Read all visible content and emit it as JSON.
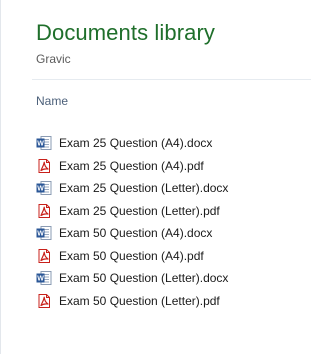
{
  "library": {
    "title": "Documents library",
    "subtitle": "Gravic"
  },
  "columns": {
    "name_label": "Name"
  },
  "files": [
    {
      "name": "Exam 25 Question (A4).docx",
      "icon": "word-document-icon"
    },
    {
      "name": "Exam 25 Question (A4).pdf",
      "icon": "pdf-document-icon"
    },
    {
      "name": "Exam 25 Question (Letter).docx",
      "icon": "word-document-icon"
    },
    {
      "name": "Exam 25 Question (Letter).pdf",
      "icon": "pdf-document-icon"
    },
    {
      "name": "Exam 50 Question (A4).docx",
      "icon": "word-document-icon"
    },
    {
      "name": "Exam 50 Question (A4).pdf",
      "icon": "pdf-document-icon"
    },
    {
      "name": "Exam 50 Question (Letter).docx",
      "icon": "word-document-icon"
    },
    {
      "name": "Exam 50 Question (Letter).pdf",
      "icon": "pdf-document-icon"
    }
  ],
  "colors": {
    "title_green": "#1f6f2b",
    "word_blue": "#2b5797",
    "pdf_red": "#c8211b"
  }
}
